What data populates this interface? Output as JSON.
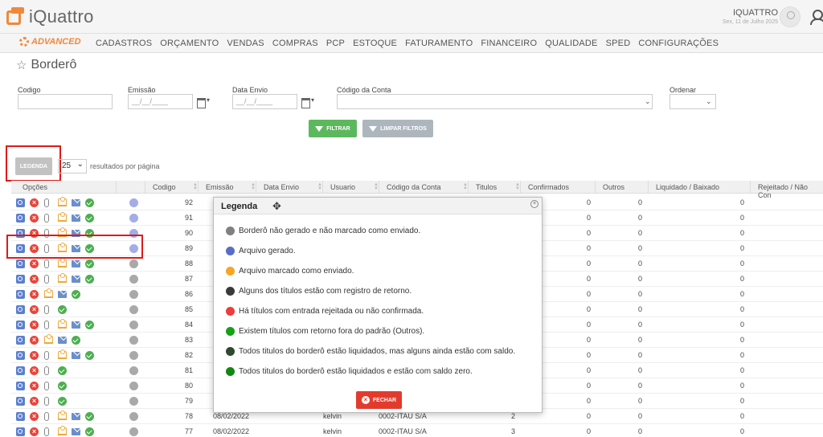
{
  "app": {
    "logo": "iQuattro",
    "user_name": "IQUATTRO",
    "user_date": "Sex, 11 de Julho 2025"
  },
  "nav": {
    "advanced": "ADVANCED",
    "items": [
      "CADASTROS",
      "ORÇAMENTO",
      "VENDAS",
      "COMPRAS",
      "PCP",
      "ESTOQUE",
      "FATURAMENTO",
      "FINANCEIRO",
      "QUALIDADE",
      "SPED",
      "CONFIGURAÇÕES"
    ]
  },
  "page": {
    "title": "Borderô"
  },
  "filters": {
    "codigo_label": "Codigo",
    "emissao_label": "Emissão",
    "emissao_ph": "__/__/____",
    "data_envio_label": "Data Envio",
    "data_envio_ph": "__/__/____",
    "conta_label": "Código da Conta",
    "ordenar_label": "Ordenar"
  },
  "buttons": {
    "filtrar": "FILTRAR",
    "limpar": "LIMPAR FILTROS",
    "legenda": "LEGENDA",
    "fechar": "FECHAR"
  },
  "pagination": {
    "per_page": "25",
    "per_page_label": "resultados por página"
  },
  "table": {
    "headers": [
      "Opções",
      "Codigo",
      "Emissão",
      "Data Envio",
      "Usuario",
      "Código da Conta",
      "Titulos",
      "Confirmados",
      "Outros",
      "Liquidado / Baixado",
      "Rejeitado / Não Con"
    ],
    "rows": [
      {
        "codigo": "92",
        "status": "#a3aee6",
        "icons": [
          "mag",
          "x",
          "clip",
          "up",
          "mail",
          "ok"
        ],
        "emissao": "",
        "envio": "",
        "usuario": "",
        "conta": "",
        "titulos": "",
        "confirmados": "0",
        "outros": "0",
        "liquidado": "0"
      },
      {
        "codigo": "91",
        "status": "#a3aee6",
        "icons": [
          "mag",
          "x",
          "clip",
          "up",
          "mail",
          "ok"
        ],
        "emissao": "",
        "envio": "",
        "usuario": "",
        "conta": "",
        "titulos": "",
        "confirmados": "0",
        "outros": "0",
        "liquidado": "0"
      },
      {
        "codigo": "90",
        "status": "#a3aee6",
        "icons": [
          "mag",
          "x",
          "clip",
          "up",
          "mail",
          "ok"
        ],
        "emissao": "",
        "envio": "",
        "usuario": "",
        "conta": "",
        "titulos": "",
        "confirmados": "0",
        "outros": "0",
        "liquidado": "0"
      },
      {
        "codigo": "89",
        "status": "#a3aee6",
        "icons": [
          "mag",
          "x",
          "clip",
          "up",
          "mail",
          "ok"
        ],
        "emissao": "",
        "envio": "",
        "usuario": "",
        "conta": "",
        "titulos": "",
        "confirmados": "0",
        "outros": "0",
        "liquidado": "0"
      },
      {
        "codigo": "88",
        "status": "#a9a9a9",
        "icons": [
          "mag",
          "x",
          "clip",
          "up",
          "mail",
          "ok"
        ],
        "emissao": "",
        "envio": "",
        "usuario": "",
        "conta": "",
        "titulos": "",
        "confirmados": "0",
        "outros": "0",
        "liquidado": "0"
      },
      {
        "codigo": "87",
        "status": "#a9a9a9",
        "icons": [
          "mag",
          "x",
          "clip",
          "up",
          "mail",
          "ok"
        ],
        "emissao": "",
        "envio": "",
        "usuario": "",
        "conta": "",
        "titulos": "",
        "confirmados": "0",
        "outros": "0",
        "liquidado": "0"
      },
      {
        "codigo": "86",
        "status": "#a9a9a9",
        "icons": [
          "mag",
          "x",
          "up",
          "mail",
          "ok"
        ],
        "emissao": "",
        "envio": "",
        "usuario": "",
        "conta": "",
        "titulos": "",
        "confirmados": "0",
        "outros": "0",
        "liquidado": "0"
      },
      {
        "codigo": "85",
        "status": "#a9a9a9",
        "icons": [
          "mag",
          "x",
          "clip",
          "ok"
        ],
        "emissao": "",
        "envio": "",
        "usuario": "",
        "conta": "",
        "titulos": "",
        "confirmados": "0",
        "outros": "0",
        "liquidado": "0"
      },
      {
        "codigo": "84",
        "status": "#a9a9a9",
        "icons": [
          "mag",
          "x",
          "clip",
          "up",
          "mail",
          "ok"
        ],
        "emissao": "",
        "envio": "",
        "usuario": "",
        "conta": "",
        "titulos": "",
        "confirmados": "0",
        "outros": "0",
        "liquidado": "0"
      },
      {
        "codigo": "83",
        "status": "#a9a9a9",
        "icons": [
          "mag",
          "x",
          "up",
          "mail",
          "ok"
        ],
        "emissao": "",
        "envio": "",
        "usuario": "",
        "conta": "",
        "titulos": "",
        "confirmados": "0",
        "outros": "0",
        "liquidado": "0"
      },
      {
        "codigo": "82",
        "status": "#a9a9a9",
        "icons": [
          "mag",
          "x",
          "clip",
          "up",
          "mail",
          "ok"
        ],
        "emissao": "",
        "envio": "",
        "usuario": "",
        "conta": "",
        "titulos": "",
        "confirmados": "0",
        "outros": "0",
        "liquidado": "0"
      },
      {
        "codigo": "81",
        "status": "#a9a9a9",
        "icons": [
          "mag",
          "x",
          "clip",
          "ok"
        ],
        "emissao": "",
        "envio": "",
        "usuario": "",
        "conta": "",
        "titulos": "",
        "confirmados": "0",
        "outros": "0",
        "liquidado": "0"
      },
      {
        "codigo": "80",
        "status": "#a9a9a9",
        "icons": [
          "mag",
          "x",
          "clip",
          "ok"
        ],
        "emissao": "",
        "envio": "",
        "usuario": "",
        "conta": "",
        "titulos": "",
        "confirmados": "0",
        "outros": "0",
        "liquidado": "0"
      },
      {
        "codigo": "79",
        "status": "#a9a9a9",
        "icons": [
          "mag",
          "x",
          "clip",
          "ok"
        ],
        "emissao": "",
        "envio": "",
        "usuario": "",
        "conta": "",
        "titulos": "",
        "confirmados": "0",
        "outros": "0",
        "liquidado": "0"
      },
      {
        "codigo": "78",
        "status": "#a9a9a9",
        "icons": [
          "mag",
          "x",
          "clip",
          "up",
          "mail",
          "ok"
        ],
        "emissao": "08/02/2022",
        "envio": "",
        "usuario": "kelvin",
        "conta": "0002-ITAU S/A",
        "titulos": "2",
        "confirmados": "0",
        "outros": "0",
        "liquidado": "0"
      },
      {
        "codigo": "77",
        "status": "#a9a9a9",
        "icons": [
          "mag",
          "x",
          "clip",
          "up",
          "mail",
          "ok"
        ],
        "emissao": "08/02/2022",
        "envio": "",
        "usuario": "kelvin",
        "conta": "0002-ITAU S/A",
        "titulos": "3",
        "confirmados": "0",
        "outros": "0",
        "liquidado": "0"
      }
    ]
  },
  "legend": {
    "title": "Legenda",
    "items": [
      {
        "color": "#808080",
        "text": "Borderô não gerado e não marcado como enviado."
      },
      {
        "color": "#5a6dc6",
        "text": "Arquivo gerado."
      },
      {
        "color": "#f5a623",
        "text": "Arquivo marcado como enviado."
      },
      {
        "color": "#3a3a3a",
        "text": "Alguns dos títulos estão com registro de retorno."
      },
      {
        "color": "#ee3b3b",
        "text": "Há títulos com entrada rejeitada ou não confirmada."
      },
      {
        "color": "#16a016",
        "text": "Existem títulos com retorno fora do padrão (Outros)."
      },
      {
        "color": "#2d4a2d",
        "text": "Todos titulos do borderô estão liquidados, mas alguns ainda estão com saldo."
      },
      {
        "color": "#118811",
        "text": "Todos titulos do borderô estão liquidados e estão com saldo zero."
      }
    ]
  }
}
